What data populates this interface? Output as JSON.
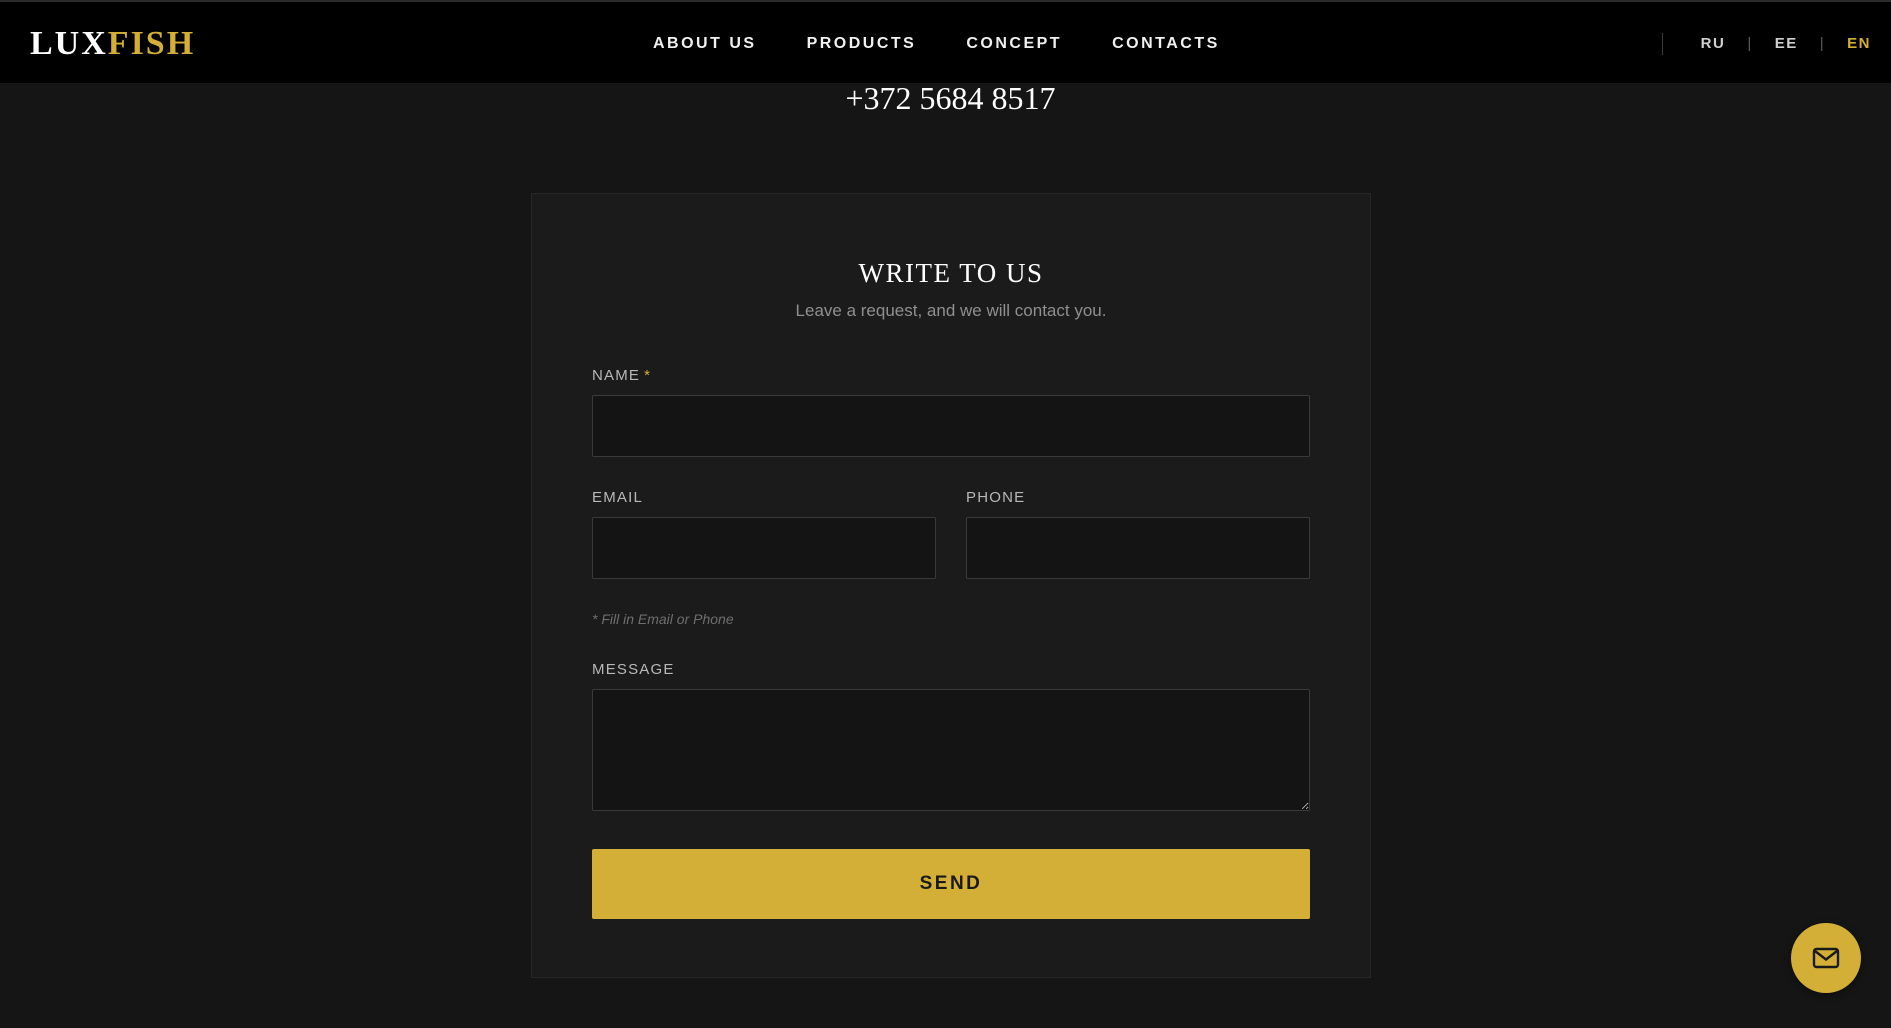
{
  "header": {
    "logo_part1": "LUX",
    "logo_part2": "FISH",
    "nav": [
      "ABOUT US",
      "PRODUCTS",
      "CONCEPT",
      "CONTACTS"
    ],
    "languages": [
      "RU",
      "EE",
      "EN"
    ],
    "active_language": "EN"
  },
  "contact": {
    "phone": "+372 5684 8517"
  },
  "form": {
    "title": "WRITE TO US",
    "subtitle": "Leave a request, and we will contact you.",
    "name_label": "NAME",
    "required_mark": "*",
    "email_label": "EMAIL",
    "phone_label": "PHONE",
    "hint": "* Fill in Email or Phone",
    "message_label": "MESSAGE",
    "send_label": "SEND",
    "name_value": "",
    "email_value": "",
    "phone_value": "",
    "message_value": ""
  },
  "floating": {
    "icon": "mail-icon"
  },
  "colors": {
    "accent": "#d4af37",
    "background": "#151515",
    "card": "#1b1b1b",
    "header": "#000000"
  }
}
